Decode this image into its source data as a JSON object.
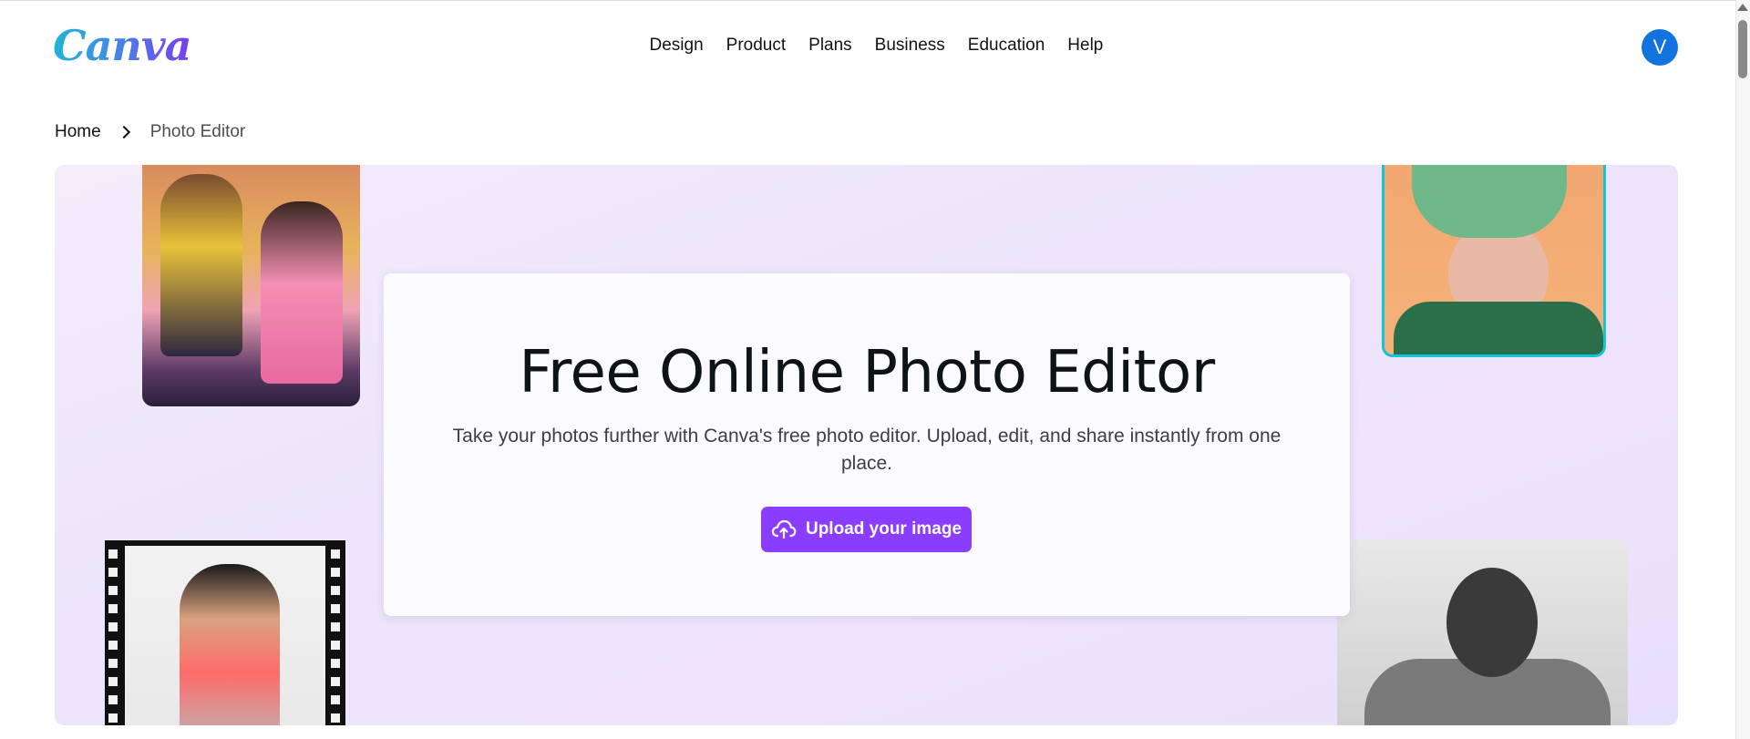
{
  "header": {
    "logo": "Canva",
    "nav": [
      "Design",
      "Product",
      "Plans",
      "Business",
      "Education",
      "Help"
    ],
    "avatar_initial": "V"
  },
  "breadcrumb": {
    "home": "Home",
    "current": "Photo Editor"
  },
  "hero": {
    "title": "Free Online Photo Editor",
    "description": "Take your photos further with Canva's free photo editor. Upload, edit, and share instantly from one place.",
    "upload_label": "Upload your image",
    "upload_icon": "cloud-upload-icon"
  },
  "colors": {
    "accent": "#8b3dff",
    "avatar": "#1273de",
    "hero_bg": "#ede6fb"
  }
}
